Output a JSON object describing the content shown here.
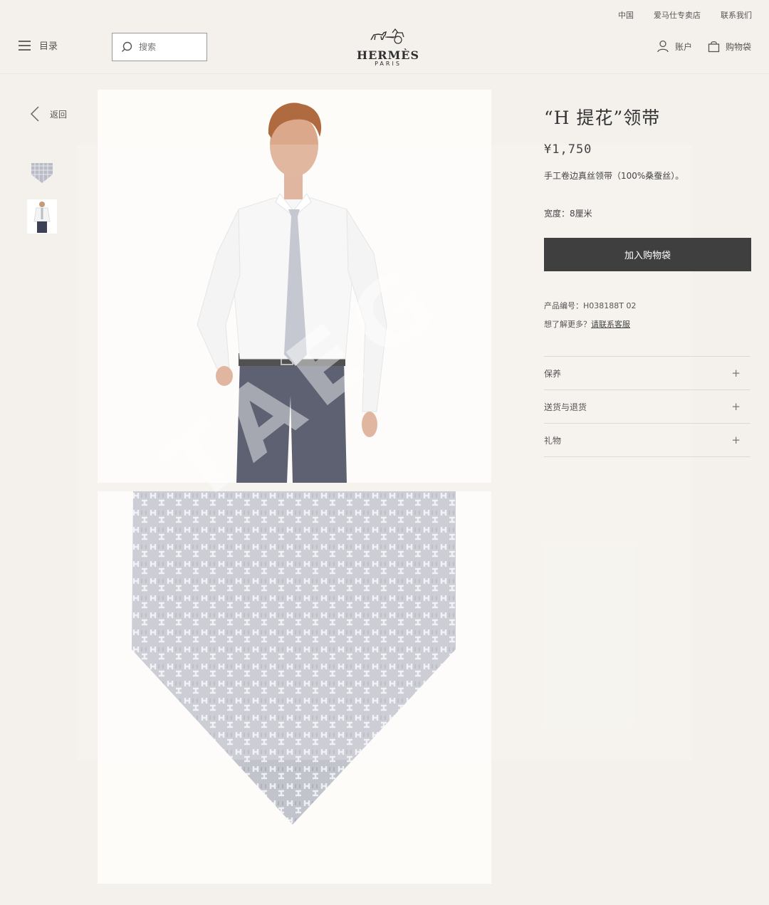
{
  "header": {
    "util_links": [
      "中国",
      "爱马仕专卖店",
      "联系我们"
    ],
    "menu_label": "目录",
    "search_placeholder": "搜索",
    "logo_name": "HERMÈS",
    "logo_city": "PARIS",
    "account_label": "账户",
    "bag_label": "购物袋"
  },
  "nav": {
    "back_label": "返回"
  },
  "product": {
    "title": "“H 提花”领带",
    "price": "¥1,750",
    "description": "手工卷边真丝领带（100%桑蚕丝）。",
    "width": "宽度：8厘米",
    "add_to_bag": "加入购物袋",
    "code": "产品编号：H038188T 02",
    "more_prefix": "想了解更多？",
    "more_link": "请联系客服"
  },
  "accordion": [
    "保养",
    "送货与退货",
    "礼物"
  ],
  "watermark": "TAEG",
  "colors": {
    "button": "#3f3f3f",
    "background": "#f4f1ec",
    "tie": "#b9bcc6"
  }
}
